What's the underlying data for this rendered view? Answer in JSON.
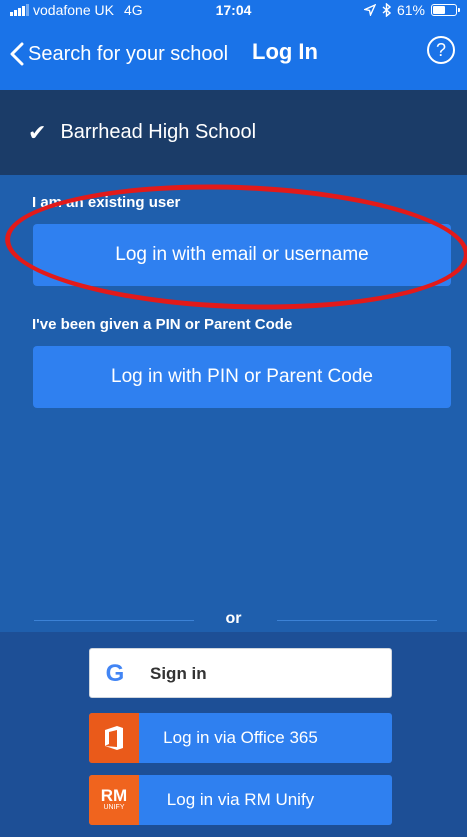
{
  "status_bar": {
    "carrier": "vodafone UK",
    "network": "4G",
    "time": "17:04",
    "battery": "61%",
    "battery_level": 0.61
  },
  "nav": {
    "back_label": "Search for your school",
    "title": "Log In",
    "help_symbol": "?"
  },
  "school": {
    "check": "✔",
    "name": "Barrhead High School"
  },
  "existing_user": {
    "label": "I am an existing user",
    "button": "Log in with email or username"
  },
  "pin": {
    "label": "I've been given a PIN or Parent Code",
    "button": "Log in with PIN or Parent Code"
  },
  "divider": {
    "label": "or"
  },
  "social": {
    "google": {
      "label": "Sign in",
      "icon": "google-icon",
      "glyph": "G"
    },
    "office": {
      "label": "Log in via Office 365",
      "icon": "office365-icon"
    },
    "rm": {
      "label": "Log in via RM Unify",
      "icon": "rm-unify-icon",
      "icon_big": "RM",
      "icon_small": "UNIFY"
    }
  },
  "colors": {
    "primary_blue": "#1a73e8",
    "school_bar": "#1b3c68",
    "button_blue": "#2f80f0",
    "annotation_red": "#e21a1a"
  }
}
